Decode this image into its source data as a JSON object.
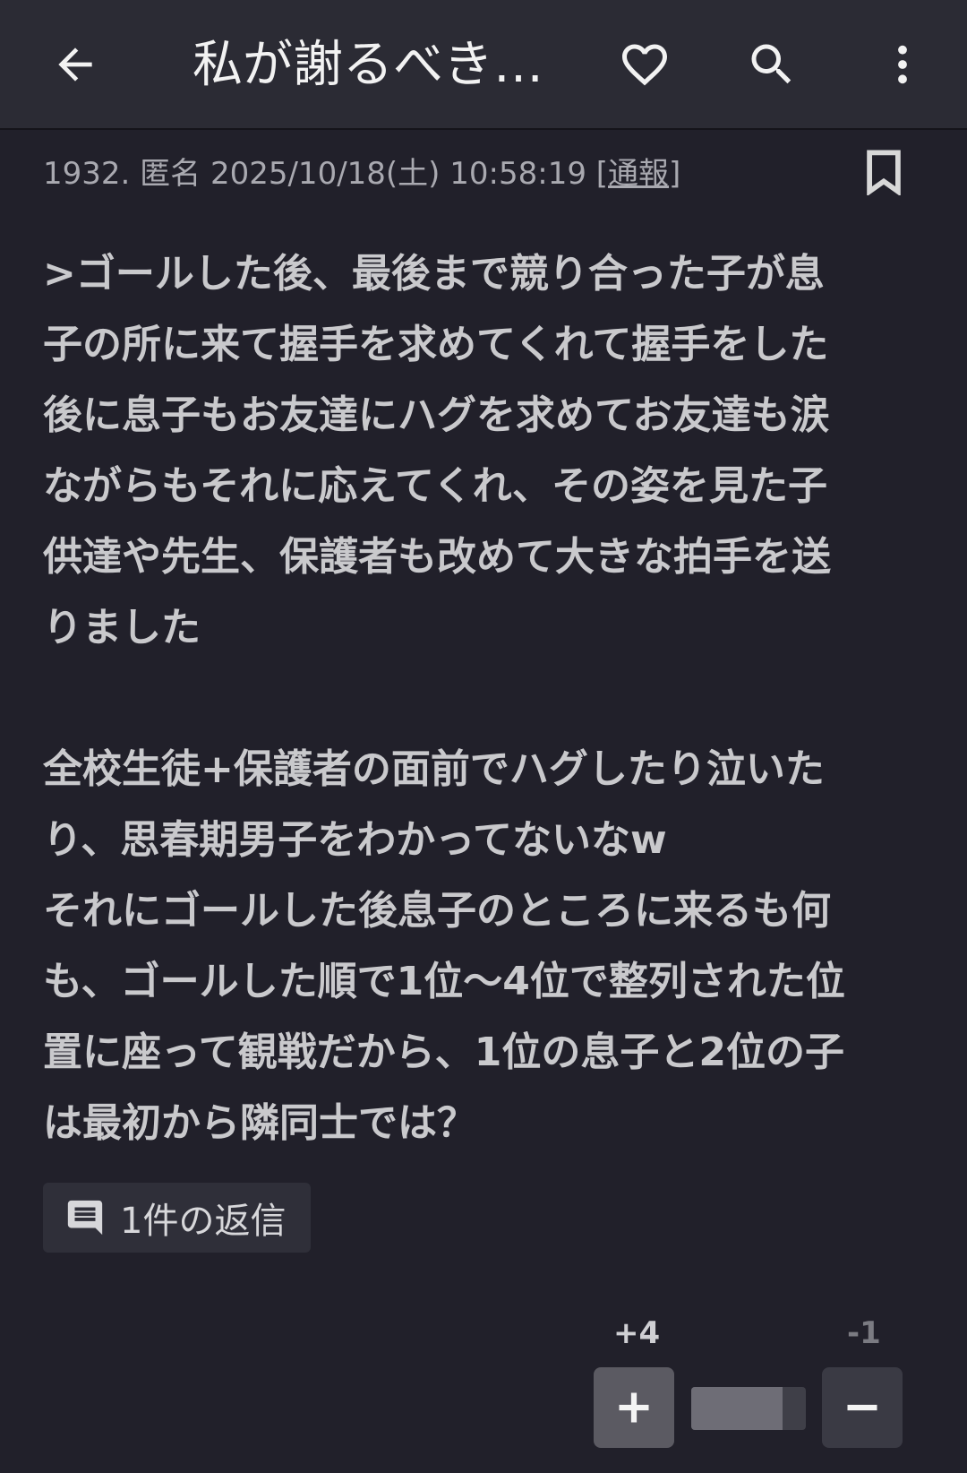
{
  "header": {
    "back_icon": "arrow-left-icon",
    "title": "私が謝るべき…",
    "favorite_icon": "heart-outline-icon",
    "search_icon": "search-icon",
    "more_icon": "more-vertical-icon"
  },
  "post": {
    "meta": "1932. 匿名 2025/10/18(土) 10:58:19 [",
    "report_label": "通報",
    "meta_end": "]",
    "bookmark_icon": "bookmark-icon",
    "body": ">ゴールした後、最後まで競り合った子が息\n子の所に来て握手を求めてくれて握手をした\n後に息子もお友達にハグを求めてお友達も涙\nながらもそれに応えてくれ、その姿を見た子\n供達や先生、保護者も改めて大きな拍手を送\nりました\n\n全校生徒+保護者の面前でハグしたり泣いた\nり、思春期男子をわかってないなw\nそれにゴールした後息子のところに来るも何\nも、ゴールした順で1位〜4位で整列された位\n置に座って観戦だから、1位の息子と2位の子\nは最初から隣同士では？",
    "reply_icon": "comment-icon",
    "reply_label": "1件の返信"
  },
  "votes": {
    "plus_count": "+4",
    "minus_count": "-1",
    "plus_icon": "plus-icon",
    "minus_icon": "minus-icon",
    "plus_ratio": 0.8
  },
  "colors": {
    "background": "#21202a",
    "header": "#2b2b34",
    "text": "#c9c9cc"
  }
}
